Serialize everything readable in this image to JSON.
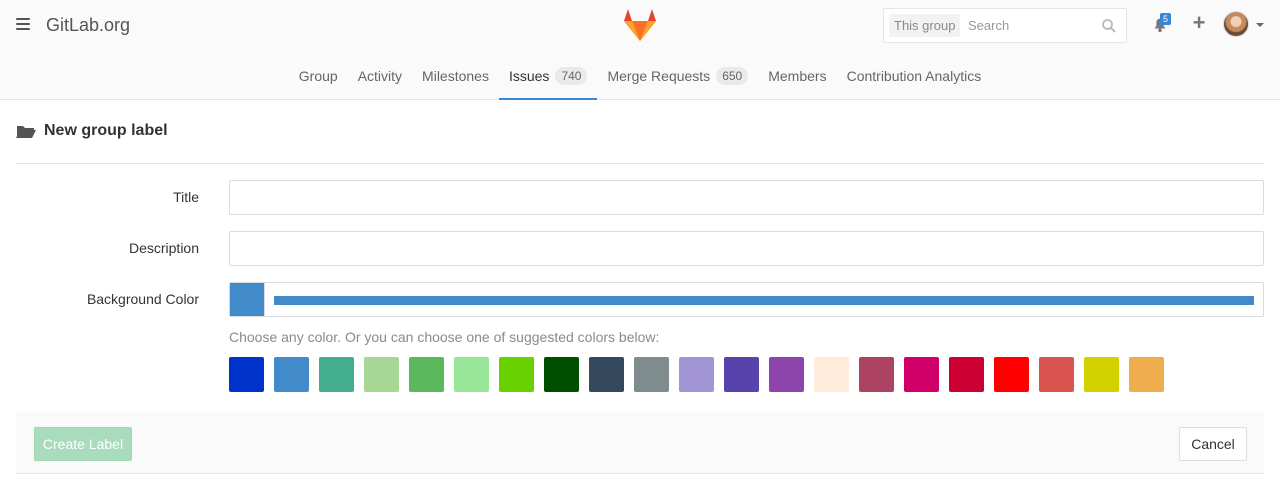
{
  "header": {
    "title": "GitLab.org",
    "search_scope": "This group",
    "search_placeholder": "Search",
    "notification_count": "5",
    "accent": "#3585d8"
  },
  "tabs": [
    {
      "label": "Group"
    },
    {
      "label": "Activity"
    },
    {
      "label": "Milestones"
    },
    {
      "label": "Issues",
      "count": "740",
      "active": true
    },
    {
      "label": "Merge Requests",
      "count": "650"
    },
    {
      "label": "Members"
    },
    {
      "label": "Contribution Analytics"
    }
  ],
  "page": {
    "title": "New group label"
  },
  "form": {
    "title_label": "Title",
    "description_label": "Description",
    "background_color_label": "Background Color",
    "background_color_value": "#428bca",
    "help_text": "Choose any color. Or you can choose one of suggested colors below:",
    "swatches": [
      "#0033cc",
      "#428bca",
      "#44ad8e",
      "#a8d695",
      "#5cb85c",
      "#99e699",
      "#69d100",
      "#004e00",
      "#34495e",
      "#7f8c8d",
      "#a295d6",
      "#5843ad",
      "#8e44ad",
      "#ffecdb",
      "#ad4363",
      "#d10069",
      "#cc0033",
      "#ff0000",
      "#d9534f",
      "#d1d100",
      "#f0ad4e"
    ]
  },
  "actions": {
    "create_label": "Create Label",
    "cancel_label": "Cancel"
  }
}
